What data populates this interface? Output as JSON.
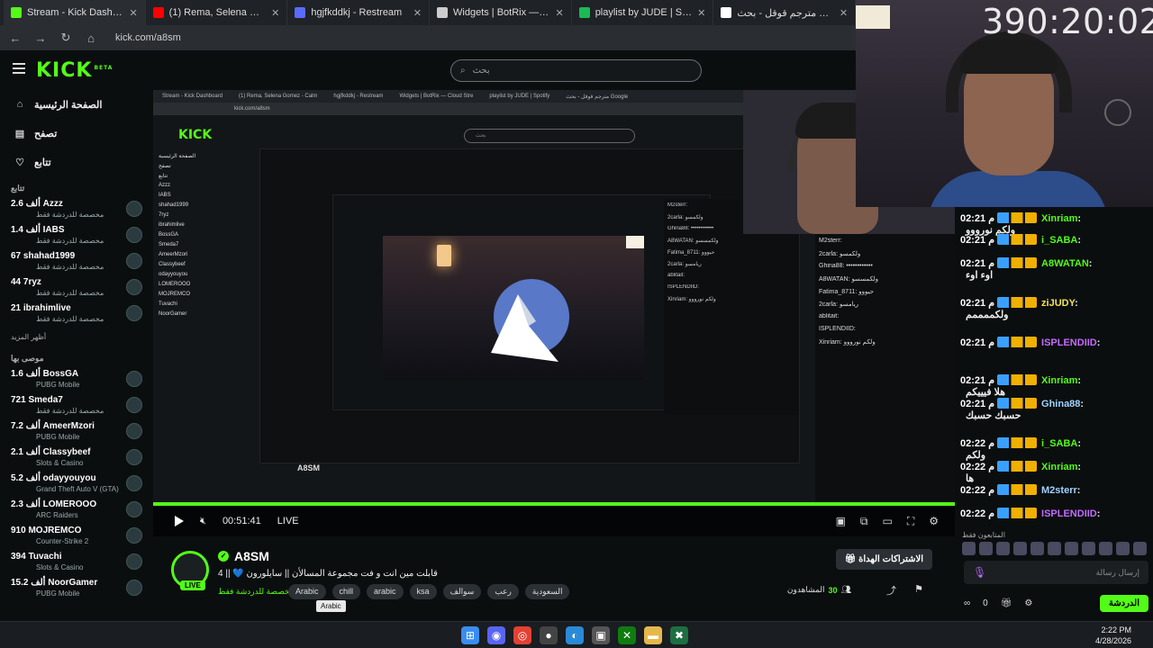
{
  "browser": {
    "tabs": [
      {
        "title": "Stream - Kick Dashboard",
        "icon": "kick-icon",
        "color": "#53fc18"
      },
      {
        "title": "(1) Rema, Selena Gomez - Calm",
        "icon": "youtube-icon",
        "color": "#ff0000"
      },
      {
        "title": "hgjfkddkj - Restream",
        "icon": "restream-icon",
        "color": "#5a6bff"
      },
      {
        "title": "Widgets | BotRix — Cloud Stre",
        "icon": "botrix-icon",
        "color": "#cccccc"
      },
      {
        "title": "playlist by JUDE | Spotify",
        "icon": "spotify-icon",
        "color": "#1db954"
      },
      {
        "title": "مترجم قوقل - بحث Google",
        "icon": "google-icon",
        "color": "#ffffff"
      }
    ],
    "url": "kick.com/a8sm"
  },
  "header": {
    "logo": "KICK",
    "logo_sup": "BETA",
    "search_placeholder": "بحث"
  },
  "sidebar": {
    "nav": [
      {
        "label": "الصفحة الرئيسية",
        "icon": "home-icon"
      },
      {
        "label": "تصفح",
        "icon": "browse-icon"
      },
      {
        "label": "تتابع",
        "icon": "heart-icon"
      }
    ],
    "following_title": "تتابع",
    "following": [
      {
        "name": "Azzz",
        "viewers": "2.6 ألف",
        "sub": "مخصصة للدردشة فقط"
      },
      {
        "name": "IABS",
        "viewers": "1.4 ألف",
        "sub": "مخصصة للدردشة فقط"
      },
      {
        "name": "shahad1999",
        "viewers": "67",
        "sub": "مخصصة للدردشة فقط"
      },
      {
        "name": "7ryz",
        "viewers": "44",
        "sub": "مخصصة للدردشة فقط"
      },
      {
        "name": "ibrahimlive",
        "viewers": "21",
        "sub": "مخصصة للدردشة فقط"
      }
    ],
    "show_more": "أظهر المزيد",
    "recommended_title": "موصى بها",
    "recommended": [
      {
        "name": "BossGA",
        "viewers": "1.6 ألف",
        "sub": "PUBG Mobile"
      },
      {
        "name": "Smeda7",
        "viewers": "721",
        "sub": "مخصصة للدردشة فقط"
      },
      {
        "name": "AmeerMzori",
        "viewers": "7.2 ألف",
        "sub": "PUBG Mobile"
      },
      {
        "name": "Classybeef",
        "viewers": "2.1 ألف",
        "sub": "Slots & Casino"
      },
      {
        "name": "odayyouyou",
        "viewers": "5.2 ألف",
        "sub": "Grand Theft Auto V (GTA)"
      },
      {
        "name": "LOMEROOO",
        "viewers": "2.3 ألف",
        "sub": "ARC Raiders"
      },
      {
        "name": "MOJREMCO",
        "viewers": "910",
        "sub": "Counter-Strike 2"
      },
      {
        "name": "Tuvachi",
        "viewers": "394",
        "sub": "Slots & Casino"
      },
      {
        "name": "NoorGamer",
        "viewers": "15.2 ألف",
        "sub": "PUBG Mobile"
      }
    ]
  },
  "player": {
    "elapsed": "00:51:41",
    "live_label": "LIVE"
  },
  "channel": {
    "name": "A8SM",
    "title": "قابلت مين انت و فت مجموعة المسالأن || سايلورون 💙 || 4",
    "category": "مخصصة للدردشة فقط",
    "live_badge": "LIVE",
    "tags": [
      "Arabic",
      "chill",
      "arabic",
      "ksa",
      "سوالف",
      "رعب",
      "السعودية"
    ],
    "tooltip": "Arabic",
    "subscribe_label": "الاشتراكات الهداة",
    "viewers_label": "المشاهدون",
    "viewers_count": "30"
  },
  "overlay": {
    "timer": "390:20:02"
  },
  "nested": {
    "side_items": [
      "الصفحة الرئيسية",
      "تصفح",
      "تتابع",
      "Azzz",
      "IABS",
      "shahad1999",
      "7ryz",
      "ibrahimlive",
      "BossGA",
      "Smeda7",
      "AmeerMzori",
      "Classybeef",
      "odayyouyou",
      "LOMEROOO",
      "MOJREMCO",
      "Tuvachi",
      "NoorGamer"
    ],
    "cam_text": "39",
    "chat_lines": [
      "M2sterr:",
      "2carla: ولكمسو",
      "Ghina88: ••••••••••••",
      "A8WATAN: ولكمسسو",
      "Fatima_8711: حيووو",
      "2carla: ريامسو",
      "ablitait:",
      "ISPLENDIID:",
      "Xinriam: ولكم نورووو"
    ]
  },
  "chat": {
    "messages": [
      {
        "time": "02:21 م",
        "user": "Xinriam",
        "color": "#53fc18",
        "text": "ولكم نورووو"
      },
      {
        "time": "02:21 م",
        "user": "i_SABA",
        "color": "#53fc18",
        "text": ""
      },
      {
        "time": "02:21 م",
        "user": "A8WATAN",
        "color": "#53fc18",
        "text": "اوء اوء"
      },
      {
        "time": "02:21 م",
        "user": "ziJUDY",
        "color": "#f3e44a",
        "text": "ولكممممم"
      },
      {
        "time": "02:21 م",
        "user": "ISPLENDIID",
        "color": "#c36bff",
        "text": ""
      },
      {
        "time": "02:21 م",
        "user": "Xinriam",
        "color": "#53fc18",
        "text": "هلا فيييكم"
      },
      {
        "time": "02:21 م",
        "user": "Ghina88",
        "color": "#9fd3ff",
        "text": "حسبك حسبك"
      },
      {
        "time": "02:22 م",
        "user": "i_SABA",
        "color": "#53fc18",
        "text": "ولكم"
      },
      {
        "time": "02:22 م",
        "user": "Xinriam",
        "color": "#53fc18",
        "text": "ها"
      },
      {
        "time": "02:22 م",
        "user": "M2sterr",
        "color": "#9fd3ff",
        "text": ""
      },
      {
        "time": "02:22 م",
        "user": "ISPLENDIID",
        "color": "#c36bff",
        "text": ""
      }
    ],
    "pinned": "المتابعون فقط",
    "input_placeholder": "إرسال رسالة",
    "points": "0",
    "send_label": "الدردشة"
  },
  "taskbar": {
    "time": "2:22 PM",
    "date": "4/28/2026",
    "apps": [
      "windows-icon",
      "discord-icon",
      "chrome-icon",
      "obs-icon",
      "edge-icon",
      "capture-icon",
      "xbox-icon",
      "folder-icon",
      "excel-icon"
    ]
  },
  "colors": {
    "accent": "#53fc18",
    "background": "#0b0e0f"
  }
}
